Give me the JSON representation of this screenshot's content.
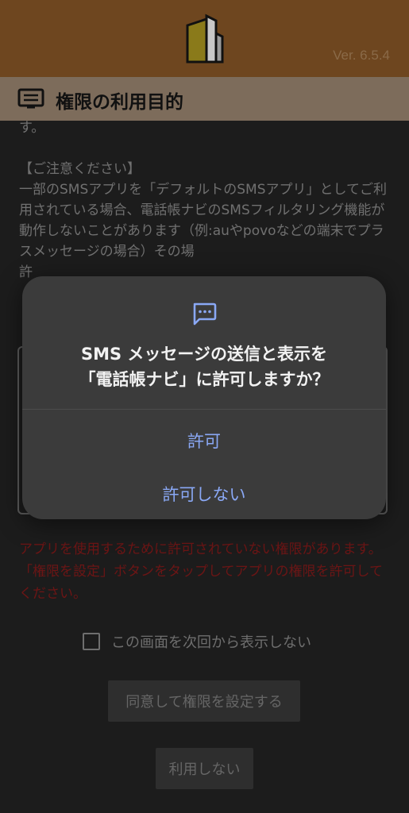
{
  "header": {
    "version": "Ver. 6.5.4",
    "logo": "building-logo-icon"
  },
  "titlebar": {
    "icon": "list-document-icon",
    "title": "権限の利用目的"
  },
  "content": {
    "body": "す。\n\n【ご注意ください】\n一部のSMSアプリを「デフォルトのSMSアプリ」としてご利用されている場合、電話帳ナビのSMSフィルタリング機能が動作しないことがあります（例:auやpovoなどの端末でプラスメッセージの場合）その場\n許",
    "warning": "アプリを使用するために許可されていない権限があります。「権限を設定」ボタンをタップしてアプリの権限を許可してください。",
    "checkbox_label": "この画面を次回から表示しない",
    "agree_button": "同意して権限を設定する",
    "decline_button": "利用しない"
  },
  "dialog": {
    "icon": "sms-message-icon",
    "title_line1": "SMS メッセージの送信と表示を",
    "title_line2": "「電話帳ナビ」に許可しますか？",
    "allow": "許可",
    "deny": "許可しない"
  },
  "colors": {
    "header_bg": "#6e461f",
    "dialog_bg": "#3b3b3b",
    "accent": "#8aa8f5",
    "warning": "#6c1515"
  }
}
